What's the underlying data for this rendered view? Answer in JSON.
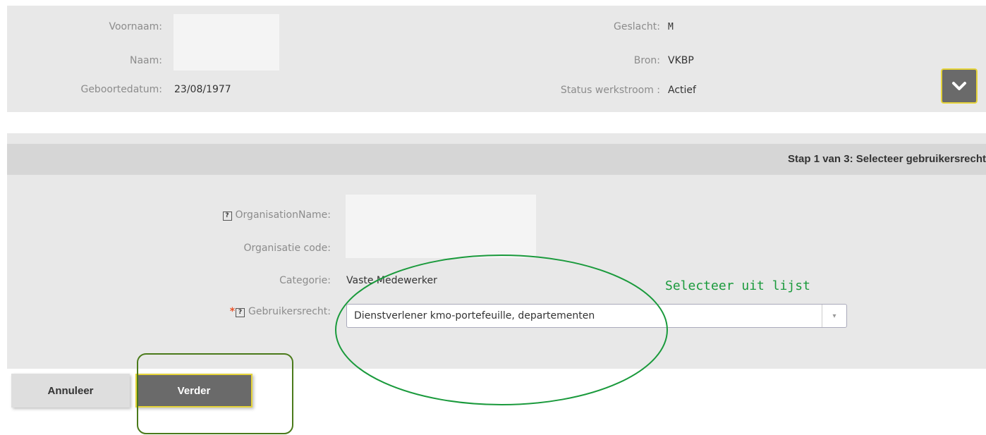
{
  "person": {
    "voornaam_label": "Voornaam:",
    "naam_label": "Naam:",
    "geboortedatum_label": "Geboortedatum:",
    "geboortedatum_value": "23/08/1977",
    "geslacht_label": "Geslacht:",
    "geslacht_value": "M",
    "bron_label": "Bron:",
    "bron_value": "VKBP",
    "status_label": "Status werkstroom :",
    "status_value": "Actief",
    "expand_icon": "chevron-down-icon"
  },
  "step": {
    "title": "Stap 1 van 3: Selecteer gebruikersrecht"
  },
  "form": {
    "help_glyph": "?",
    "required_glyph": "*",
    "organisation_name_label": "OrganisationName:",
    "organisatie_code_label": "Organisatie code:",
    "categorie_label": "Categorie:",
    "categorie_value": "Vaste Medewerker",
    "gebruikersrecht_label": "Gebruikersrecht:",
    "gebruikersrecht_selected": "Dienstverlener kmo-portefeuille, departementen",
    "select_arrow": "▾"
  },
  "annotation": {
    "hint_text": "Selecteer uit lijst",
    "highlight_color": "#1a9a3c",
    "button_frame_color": "#4a7a1a"
  },
  "buttons": {
    "cancel_label": "Annuleer",
    "next_label": "Verder"
  },
  "colors": {
    "panel_bg": "#e8e8e8",
    "header_bg": "#d6d6d6",
    "primary_button": "#6a6a6a",
    "focus_border": "#e6d43a"
  }
}
